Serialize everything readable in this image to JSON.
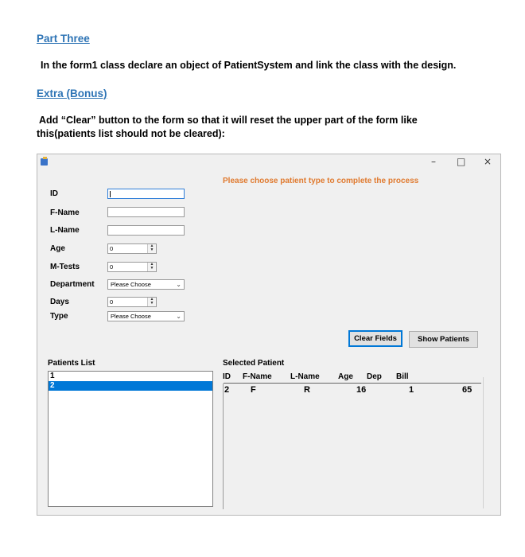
{
  "document": {
    "part_three_heading": "Part Three",
    "part_three_text": "In the form1 class declare an object of PatientSystem and link the class with the design.",
    "extra_heading": "Extra (Bonus)",
    "extra_text_line1": "Add “Clear” button to the form so that it will reset the upper part of the form like",
    "extra_text_line2": "this(patients list should not be cleared):"
  },
  "window": {
    "minimize": "–",
    "maximize": "□",
    "close": "×",
    "icon": "form-app-icon"
  },
  "form": {
    "labels": {
      "id": "ID",
      "fname": "F-Name",
      "lname": "L-Name",
      "age": "Age",
      "mtests": "M-Tests",
      "department": "Department",
      "days": "Days",
      "type": "Type"
    },
    "values": {
      "id": "",
      "fname": "",
      "lname": "",
      "age": "0",
      "mtests": "0",
      "department": "Please Choose",
      "days": "0",
      "type": "Please Choose"
    },
    "message": "Please choose patient type to complete the process",
    "clear_button": "Clear Fields",
    "show_button": "Show Patients"
  },
  "patients_list": {
    "label": "Patients List",
    "items": [
      "1",
      "2"
    ],
    "selected_index": 1
  },
  "selected_patient": {
    "label": "Selected Patient",
    "columns": [
      "ID",
      "F-Name",
      "L-Name",
      "Age",
      "Dep",
      "Bill"
    ],
    "row": [
      "2",
      "F",
      "R",
      "16",
      "1",
      "65"
    ]
  },
  "colors": {
    "heading": "#2e74b5",
    "message": "#e07a2f",
    "selection": "#0078d7"
  }
}
